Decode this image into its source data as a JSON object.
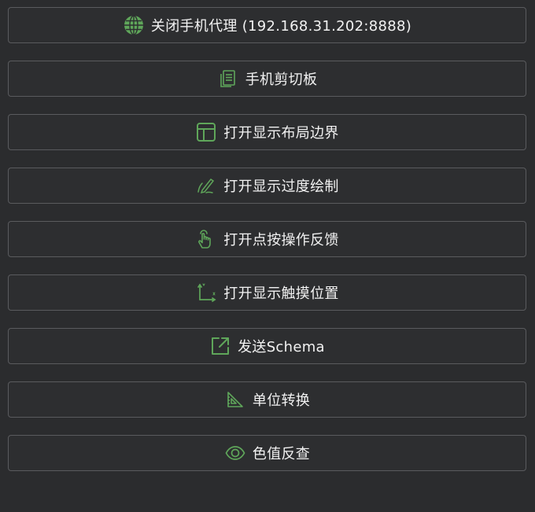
{
  "accent_color": "#5fa65a",
  "buttons": [
    {
      "label": "关闭手机代理 (192.168.31.202:8888)",
      "icon": "globe-icon"
    },
    {
      "label": "手机剪切板",
      "icon": "clipboard-icon"
    },
    {
      "label": "打开显示布局边界",
      "icon": "layout-icon"
    },
    {
      "label": "打开显示过度绘制",
      "icon": "pen-icon"
    },
    {
      "label": "打开点按操作反馈",
      "icon": "touch-hand-icon"
    },
    {
      "label": "打开显示触摸位置",
      "icon": "axis-icon"
    },
    {
      "label": "发送Schema",
      "icon": "external-link-icon"
    },
    {
      "label": "单位转换",
      "icon": "set-square-icon"
    },
    {
      "label": "色值反查",
      "icon": "eye-icon"
    }
  ]
}
